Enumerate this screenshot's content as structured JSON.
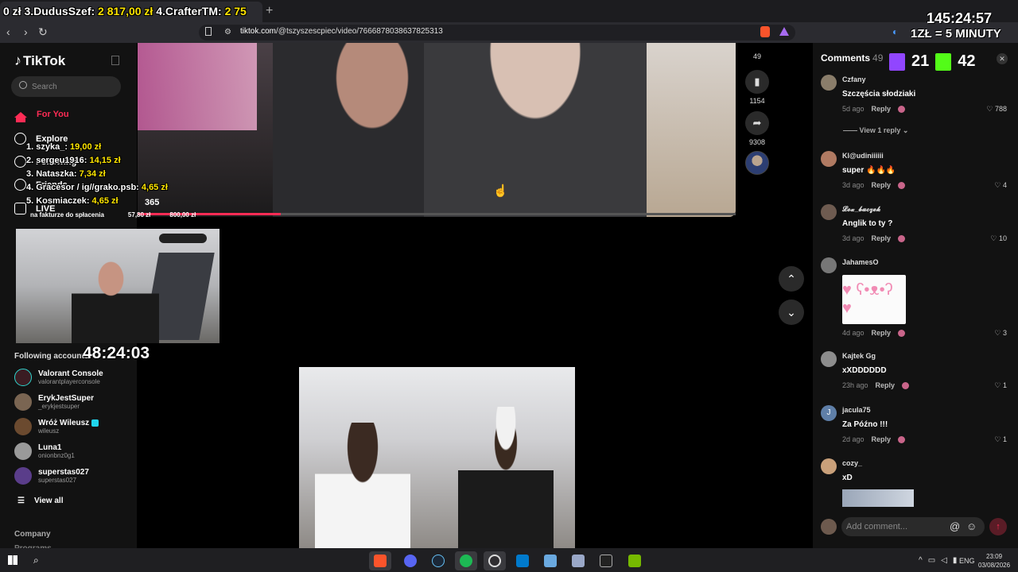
{
  "overlay_top": {
    "rank3_prefix": "0 zł 3.",
    "rank3_name": "DudusSzef:",
    "rank3_amount": "2 817,00 zł",
    "rank4_prefix": "4.",
    "rank4_name": "CrafterTM:",
    "rank4_amount": "2 75"
  },
  "overlay_clock": "145:24:57",
  "overlay_rate": "1ZŁ = 5 MINUTY",
  "viewer_counts": {
    "twitch": "21",
    "kick": "42"
  },
  "donors": [
    {
      "rank_name": "1. szyka_:",
      "amount": "19,00 zł"
    },
    {
      "rank_name": "2. sergeu1916:",
      "amount": "14,15 zł"
    },
    {
      "rank_name": "3. Nataszka:",
      "amount": "7,34 zł"
    },
    {
      "rank_name": "4. Gracesor / ig//grako.psb:",
      "amount": "4,65 zł"
    },
    {
      "rank_name": "5. Kosmiaczek:",
      "amount": "4,65 zł"
    }
  ],
  "donor_extra": "365",
  "goal": {
    "label": "na fakturze do spłacenia",
    "current": "57,80 zł",
    "target": "800,00 zł",
    "progress": 0.072
  },
  "stream_timer": "48:24:03",
  "browser": {
    "url_host": "tiktok.com",
    "url_path": "/@tszyszescpiec/video/7666878038637825313"
  },
  "sidebar": {
    "logo": "TikTok",
    "search_placeholder": "Search",
    "nav": [
      {
        "label": "For You"
      },
      {
        "label": "Explore"
      },
      {
        "label": "Following"
      },
      {
        "label": "Friends"
      },
      {
        "label": "LIVE"
      }
    ],
    "following_title": "Following accounts",
    "accounts": [
      {
        "name": "Valorant Console",
        "handle": "valorantplayerconsole",
        "color": "#3a1c22"
      },
      {
        "name": "ErykJestSuper",
        "handle": "_erykjestsuper",
        "color": "#7a6552"
      },
      {
        "name": "Wróż Wileusz",
        "handle": "wileusz",
        "color": "#6b4a2f"
      },
      {
        "name": "Luna1",
        "handle": "onionbnz0g1",
        "color": "#9a9a9a"
      },
      {
        "name": "superstas027",
        "handle": "superstas027",
        "color": "#5a3d8a"
      }
    ],
    "view_all": "View all",
    "company": "Company",
    "programs": "Programs"
  },
  "video": {
    "actions": [
      {
        "icon": "heart-icon",
        "count": "49"
      },
      {
        "icon": "bookmark-icon",
        "count": "1154"
      },
      {
        "icon": "share-icon",
        "count": "9308"
      }
    ],
    "progress": 0.24
  },
  "comments": {
    "title": "Comments",
    "count": "49",
    "reply_label": "Reply",
    "view_reply": "View 1 reply",
    "add_placeholder": "Add comment...",
    "items": [
      {
        "user": "Czfany",
        "text": "Szczęścia słodziaki",
        "time": "5d ago",
        "likes": "788",
        "color": "#8a7d6a"
      },
      {
        "user": "Kl@udiniiiiii",
        "text": "super 🔥🔥🔥",
        "time": "3d ago",
        "likes": "4",
        "color": "#b07a62"
      },
      {
        "user": "𝓛𝓸𝔁_𝓫𝓪𝓬𝔃𝓮𝓴",
        "text": "Anglik to ty ?",
        "time": "3d ago",
        "likes": "10",
        "color": "#6e5b50"
      },
      {
        "user": "JahamesO",
        "text": "",
        "time": "4d ago",
        "likes": "3",
        "color": "#777"
      },
      {
        "user": "Kajtek Gg",
        "text": "xXDDDDDD",
        "time": "23h ago",
        "likes": "1",
        "color": "#8d8d8d"
      },
      {
        "user": "jacula75",
        "text": "Za Późno !!!",
        "time": "2d ago",
        "likes": "1",
        "color": "#5f7fa8",
        "initial": "J"
      },
      {
        "user": "cozy_",
        "text": "xD",
        "time": "",
        "likes": "",
        "color": "#c9a07a"
      }
    ]
  },
  "taskbar": {
    "lang": "ENG",
    "time": "23:09",
    "date": "03/08/2026"
  },
  "colors": {
    "tiktok_red": "#fe2c55",
    "donation_yellow": "#ffe600",
    "twitch": "#9146ff",
    "kick": "#53fc18"
  }
}
